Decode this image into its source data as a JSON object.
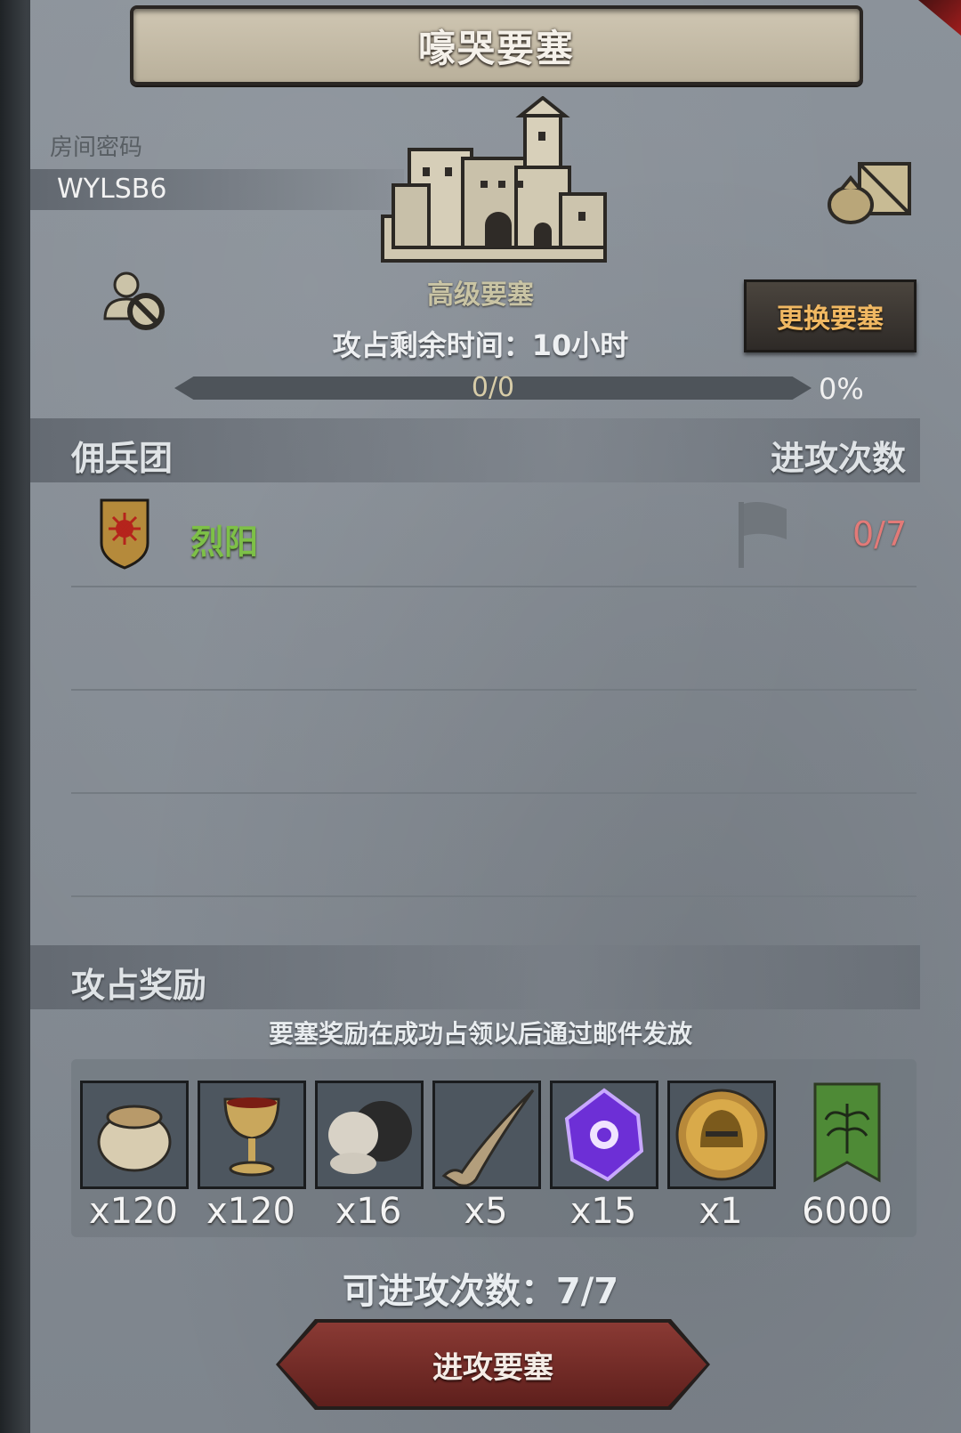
{
  "header": {
    "title": "嚎哭要塞"
  },
  "room": {
    "label": "房间密码",
    "code": "WYLSB6"
  },
  "fortress": {
    "grade": "高级要塞",
    "remaining_time": "攻占剩余时间：10小时",
    "change_button": "更换要塞",
    "progress_text": "0/0",
    "progress_percent": "0%",
    "progress_fraction": 0
  },
  "mercenary": {
    "section_title": "佣兵团",
    "attack_count_header": "进攻次数",
    "rows": [
      {
        "name": "烈阳",
        "attacks": "0/7",
        "name_color": "#7dc047"
      }
    ]
  },
  "rewards": {
    "section_title": "攻占奖励",
    "note": "要塞奖励在成功占领以后通过邮件发放",
    "items": [
      {
        "icon": "grain-sack-icon",
        "qty": "x120"
      },
      {
        "icon": "goblet-icon",
        "qty": "x120"
      },
      {
        "icon": "ore-rock-icon",
        "qty": "x16"
      },
      {
        "icon": "horn-icon",
        "qty": "x5"
      },
      {
        "icon": "purple-crystal-icon",
        "qty": "x15"
      },
      {
        "icon": "knight-helmet-coin-icon",
        "qty": "x1"
      },
      {
        "icon": "green-tree-banner-icon",
        "qty": "6000"
      }
    ]
  },
  "footer": {
    "attacks_remaining": "可进攻次数：7/7",
    "attack_button": "进攻要塞"
  }
}
